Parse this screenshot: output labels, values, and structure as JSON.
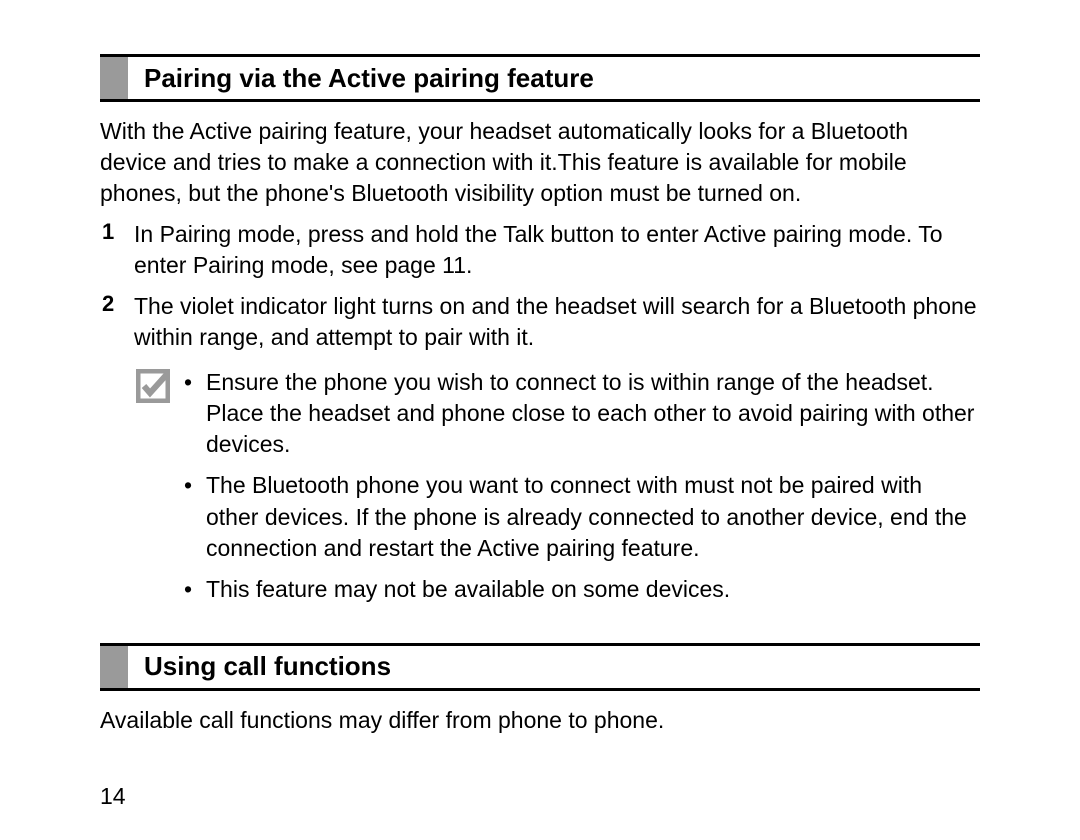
{
  "section1": {
    "heading": "Pairing via the Active pairing feature",
    "intro": "With the Active pairing feature, your headset automatically looks for a Bluetooth device and tries to make a connection with it.This feature is available for mobile phones, but the phone's Bluetooth visibility option must be turned on.",
    "steps": [
      {
        "num": "1",
        "text": "In Pairing mode, press and hold the Talk button to enter Active pairing mode. To enter Pairing mode, see page 11."
      },
      {
        "num": "2",
        "text": "The violet indicator light turns on and the headset will search for a Bluetooth phone within range, and attempt to pair with it."
      }
    ],
    "notes": [
      "Ensure the phone you wish to connect to is within range of the headset. Place the headset and phone close to each other to avoid pairing with other devices.",
      "The Bluetooth phone you want to connect with must not be paired with other devices. If the phone is already connected to another device, end the connection and restart the Active pairing feature.",
      "This feature may not be available on some devices."
    ]
  },
  "section2": {
    "heading": "Using call functions",
    "body": "Available call functions may differ from phone to phone."
  },
  "pageNumber": "14"
}
